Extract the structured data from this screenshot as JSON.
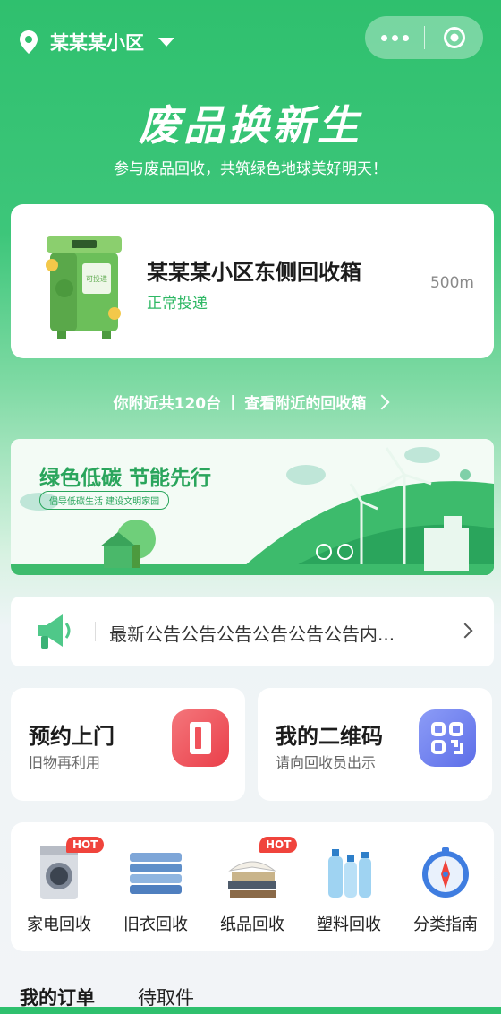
{
  "header": {
    "location": "某某某小区"
  },
  "hero": {
    "title": "废品换新生",
    "subtitle": "参与废品回收，共筑绿色地球美好明天！"
  },
  "station": {
    "name": "某某某小区东侧回收箱",
    "status": "正常投递",
    "distance": "500m",
    "bin_label": "可投递"
  },
  "nearby": {
    "count_text": "你附近共120台",
    "link_text": "查看附近的回收箱"
  },
  "banner": {
    "headline": "绿色低碳 节能先行",
    "tagline": "倡导低碳生活 建设文明家园"
  },
  "notice": {
    "text": "最新公告公告公告公告公告公告内..."
  },
  "actions": [
    {
      "title": "预约上门",
      "subtitle": "旧物再利用",
      "color": "#f0535b"
    },
    {
      "title": "我的二维码",
      "subtitle": "请向回收员出示",
      "color": "#6a7cf0"
    }
  ],
  "categories": [
    {
      "label": "家电回收",
      "hot": "HOT"
    },
    {
      "label": "旧衣回收",
      "hot": ""
    },
    {
      "label": "纸品回收",
      "hot": "HOT"
    },
    {
      "label": "塑料回收",
      "hot": ""
    },
    {
      "label": "分类指南",
      "hot": ""
    }
  ],
  "orders": {
    "tab_mine": "我的订单",
    "tab_pending": "待取件"
  },
  "colors": {
    "brand": "#2fc06e",
    "accent_red": "#f0443c"
  }
}
